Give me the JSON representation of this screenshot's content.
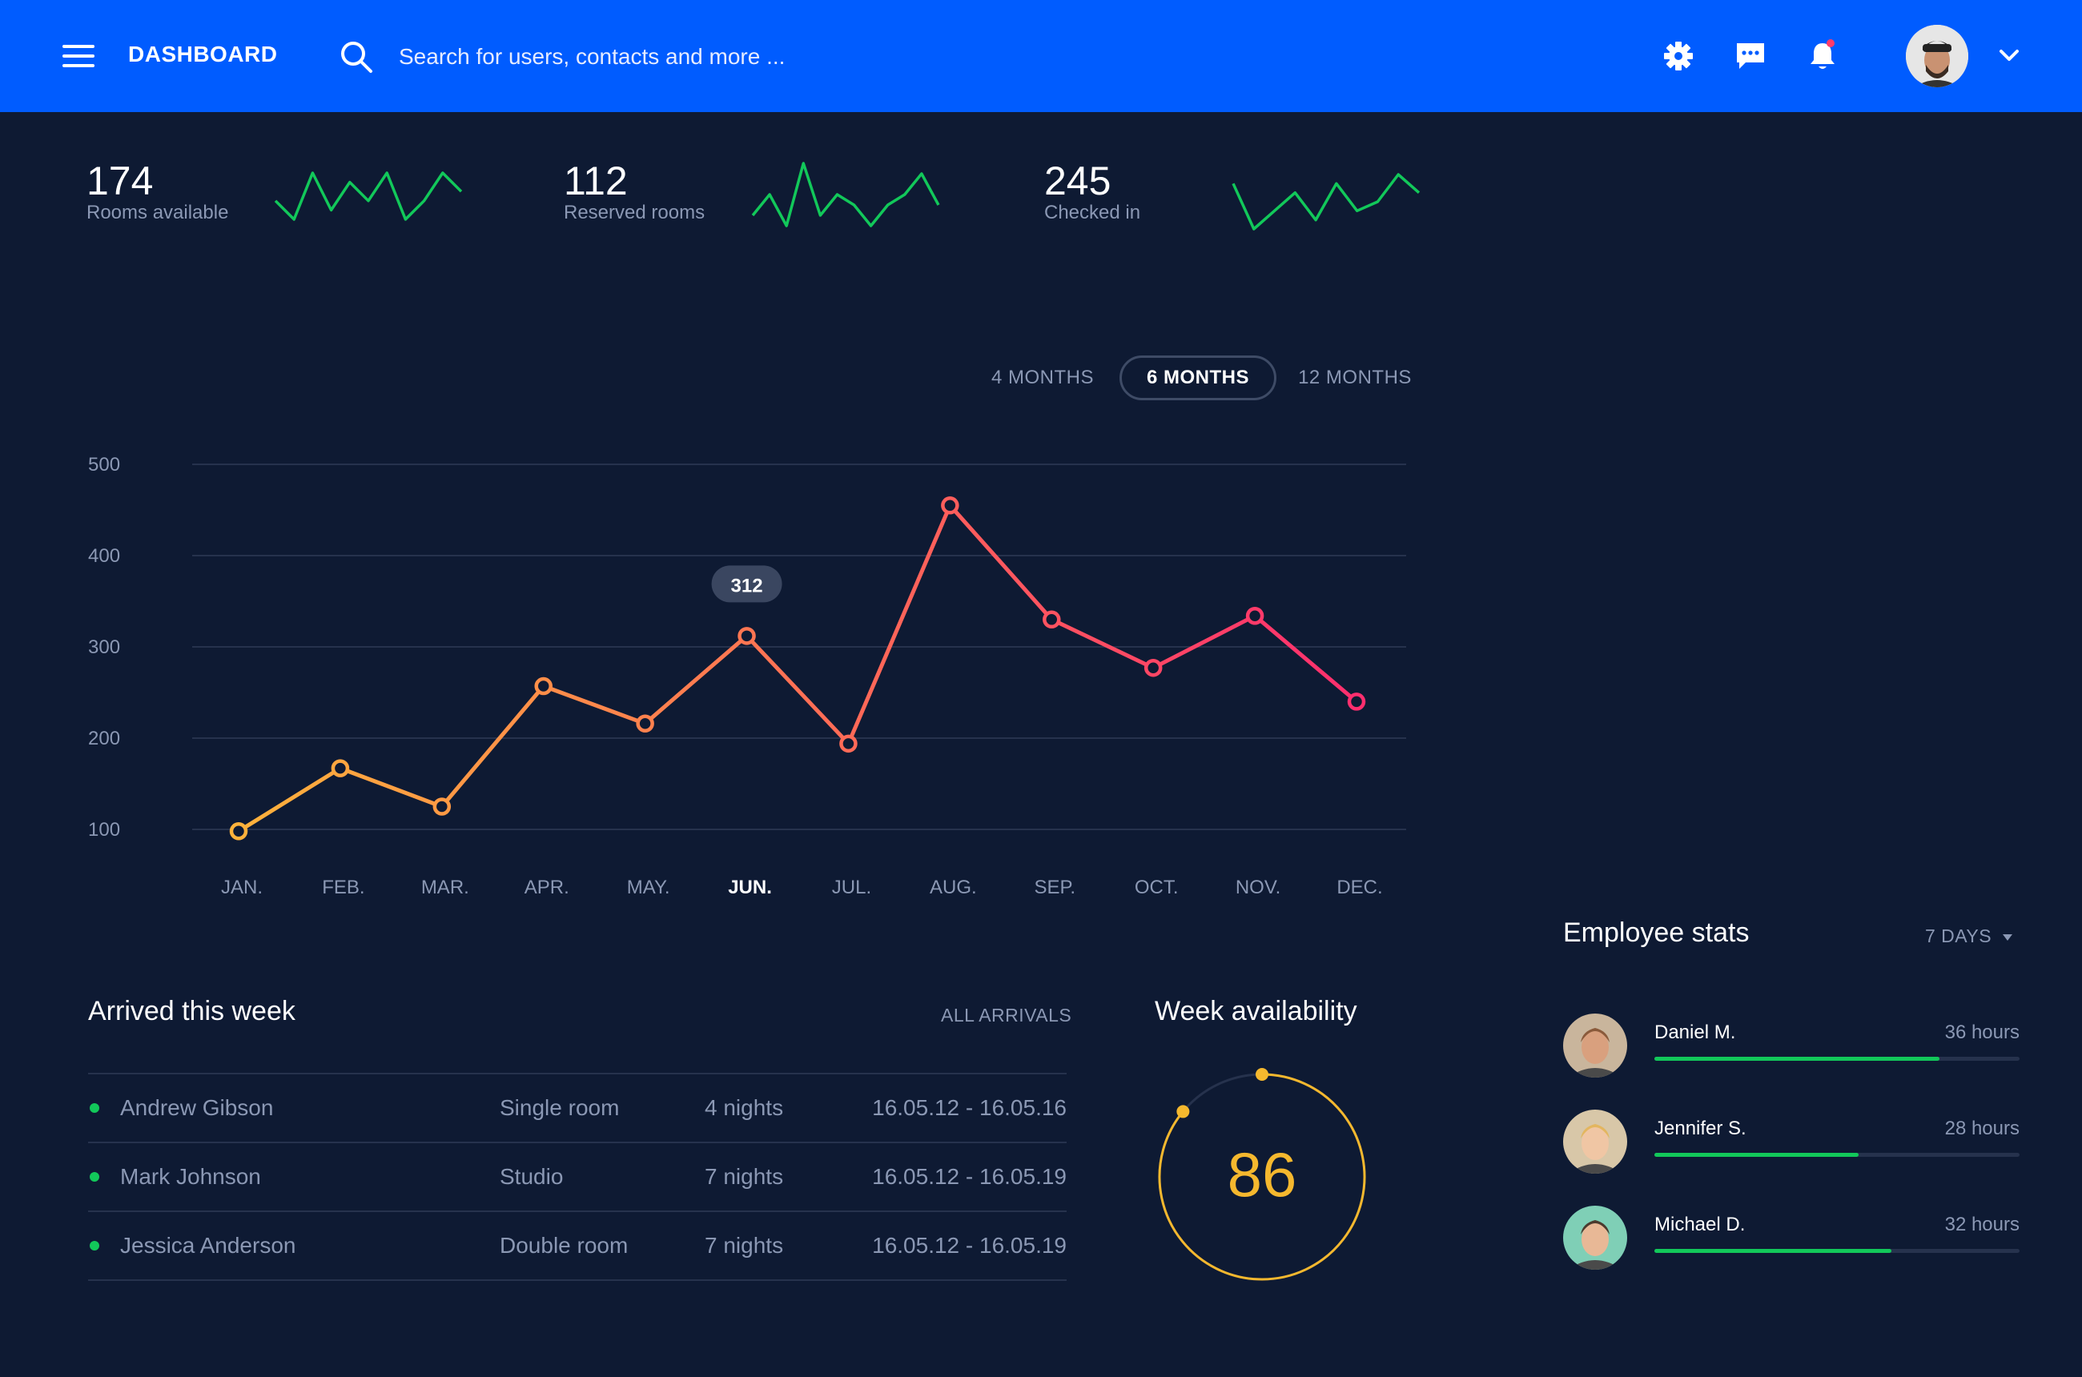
{
  "header": {
    "title": "DASHBOARD",
    "search_placeholder": "Search for users, contacts and more ...",
    "icons": [
      "menu-icon",
      "search-icon",
      "gear-icon",
      "chat-icon",
      "bell-icon",
      "avatar",
      "chevron-down-icon"
    ],
    "notification_dot_color": "#ff3b6b"
  },
  "kpis": [
    {
      "value": "174",
      "label": "Rooms available",
      "spark": [
        3,
        1,
        6,
        2,
        5,
        3,
        6,
        1,
        3,
        6,
        4
      ]
    },
    {
      "value": "112",
      "label": "Reserved rooms",
      "spark": [
        2,
        4,
        1,
        7,
        2,
        4,
        3,
        1,
        3,
        4,
        6,
        3
      ]
    },
    {
      "value": "245",
      "label": "Checked in",
      "spark": [
        6,
        1,
        3,
        5,
        2,
        6,
        3,
        4,
        7,
        5
      ]
    }
  ],
  "ranges": {
    "options": [
      "4 MONTHS",
      "6 MONTHS",
      "12 MONTHS"
    ],
    "selected": "6 MONTHS"
  },
  "chart_data": {
    "type": "line",
    "categories": [
      "JAN.",
      "FEB.",
      "MAR.",
      "APR.",
      "MAY.",
      "JUN.",
      "JUL.",
      "AUG.",
      "SEP.",
      "OCT.",
      "NOV.",
      "DEC."
    ],
    "values": [
      98,
      167,
      125,
      257,
      216,
      312,
      194,
      455,
      330,
      277,
      334,
      240
    ],
    "yticks": [
      100,
      200,
      300,
      400,
      500
    ],
    "ylim": [
      50,
      500
    ],
    "highlighted_category": "JUN.",
    "tooltip": "312",
    "gradient_colors": [
      "#ffb23b",
      "#ff2e6e"
    ],
    "grid": true
  },
  "arrivals": {
    "title": "Arrived this week",
    "link": "ALL ARRIVALS",
    "rows": [
      {
        "name": "Andrew Gibson",
        "room": "Single room",
        "nights": "4 nights",
        "dates": "16.05.12 - 16.05.16"
      },
      {
        "name": "Mark Johnson",
        "room": "Studio",
        "nights": "7 nights",
        "dates": "16.05.12 - 16.05.19"
      },
      {
        "name": "Jessica Anderson",
        "room": "Double room",
        "nights": "7 nights",
        "dates": "16.05.12 - 16.05.19"
      }
    ]
  },
  "availability": {
    "title": "Week availability",
    "value": "86",
    "color": "#f5b82e"
  },
  "employees": {
    "title": "Employee stats",
    "period": "7 DAYS",
    "rows": [
      {
        "name": "Daniel M.",
        "hours": "36 hours",
        "progress": 0.78,
        "skin": "#d9a07e",
        "hair": "#8a5a3b",
        "bg": "#c9b59c"
      },
      {
        "name": "Jennifer S.",
        "hours": "28 hours",
        "progress": 0.56,
        "skin": "#f0c6a4",
        "hair": "#e3b65f",
        "bg": "#d8c7a8"
      },
      {
        "name": "Michael D.",
        "hours": "32 hours",
        "progress": 0.65,
        "skin": "#e8b896",
        "hair": "#4b3a2e",
        "bg": "#7fcfb6"
      }
    ]
  }
}
